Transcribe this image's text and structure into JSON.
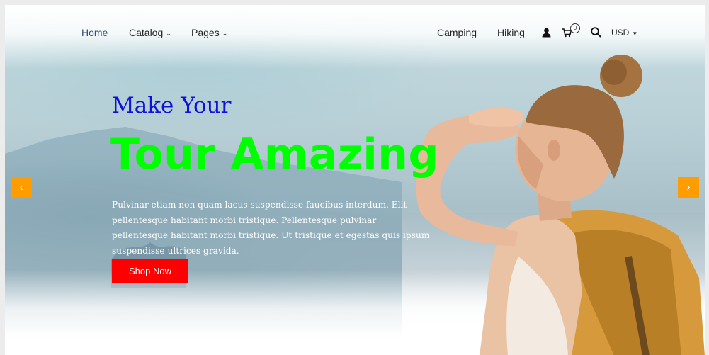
{
  "nav": {
    "left": [
      "Home",
      "Catalog",
      "Pages"
    ],
    "right": [
      "Camping",
      "Hiking"
    ],
    "cart_count": "0",
    "currency": "USD"
  },
  "hero": {
    "line1": "Make Your",
    "line2": "Tour Amazing",
    "description": "Pulvinar etiam non quam lacus suspendisse faucibus interdum. Elit pellentesque habitant morbi tristique. Pellentesque pulvinar pellentesque habitant morbi tristique. Ut tristique et egestas quis ipsum suspendisse ultrices gravida.",
    "cta": "Shop Now"
  },
  "colors": {
    "cta_background": "#ff0000",
    "headline_line1": "#1010d8",
    "headline_line2": "#00ff00",
    "slider_arrows": "#ff9c00"
  },
  "icons": [
    "user-icon",
    "cart-icon",
    "search-icon",
    "chevron-left-icon",
    "chevron-right-icon"
  ]
}
